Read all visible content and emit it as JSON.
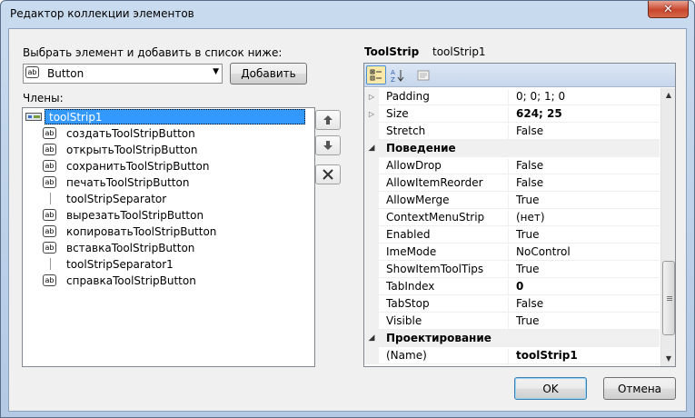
{
  "window": {
    "title": "Редактор коллекции элементов"
  },
  "left": {
    "select_label": "Выбрать элемент и добавить в список ниже:",
    "combo_icon": "ab",
    "combo_value": "Button",
    "add_button": "Добавить",
    "members_label": "Члены:",
    "members": [
      {
        "label": "toolStrip1",
        "icon": "toolstrip-icon",
        "selected": true
      },
      {
        "label": "создатьToolStripButton",
        "icon": "ab"
      },
      {
        "label": "открытьToolStripButton",
        "icon": "ab"
      },
      {
        "label": "сохранитьToolStripButton",
        "icon": "ab"
      },
      {
        "label": "печатьToolStripButton",
        "icon": "ab"
      },
      {
        "label": "toolStripSeparator",
        "icon": "separator-icon"
      },
      {
        "label": "вырезатьToolStripButton",
        "icon": "ab"
      },
      {
        "label": "копироватьToolStripButton",
        "icon": "ab"
      },
      {
        "label": "вставкаToolStripButton",
        "icon": "ab"
      },
      {
        "label": "toolStripSeparator1",
        "icon": "separator-icon"
      },
      {
        "label": "справкаToolStripButton",
        "icon": "ab"
      }
    ]
  },
  "props": {
    "type_name": "ToolStrip",
    "object_name": "toolStrip1",
    "rows": [
      {
        "kind": "prop",
        "name": "Padding",
        "value": "0; 0; 1; 0",
        "expand": "▷"
      },
      {
        "kind": "prop",
        "name": "Size",
        "value": "624; 25",
        "expand": "▷",
        "bold": true
      },
      {
        "kind": "prop",
        "name": "Stretch",
        "value": "False"
      },
      {
        "kind": "cat",
        "name": "Поведение",
        "expand": "◢"
      },
      {
        "kind": "prop",
        "name": "AllowDrop",
        "value": "False"
      },
      {
        "kind": "prop",
        "name": "AllowItemReorder",
        "value": "False"
      },
      {
        "kind": "prop",
        "name": "AllowMerge",
        "value": "True"
      },
      {
        "kind": "prop",
        "name": "ContextMenuStrip",
        "value": "(нет)"
      },
      {
        "kind": "prop",
        "name": "Enabled",
        "value": "True"
      },
      {
        "kind": "prop",
        "name": "ImeMode",
        "value": "NoControl"
      },
      {
        "kind": "prop",
        "name": "ShowItemToolTips",
        "value": "True"
      },
      {
        "kind": "prop",
        "name": "TabIndex",
        "value": "0",
        "bold": true
      },
      {
        "kind": "prop",
        "name": "TabStop",
        "value": "False"
      },
      {
        "kind": "prop",
        "name": "Visible",
        "value": "True"
      },
      {
        "kind": "cat",
        "name": "Проектирование",
        "expand": "◢"
      },
      {
        "kind": "prop",
        "name": "(Name)",
        "value": "toolStrip1",
        "bold": true
      }
    ]
  },
  "buttons": {
    "ok": "OK",
    "cancel": "Отмена"
  }
}
